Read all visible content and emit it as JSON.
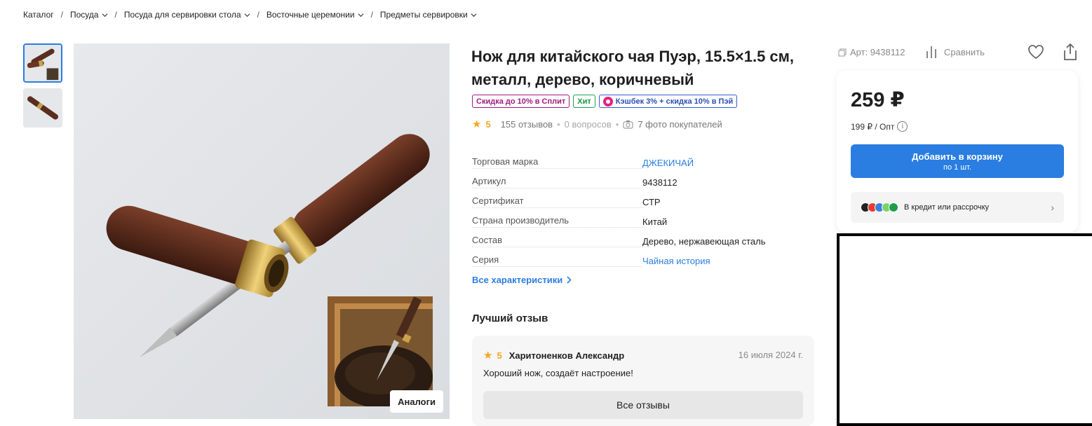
{
  "breadcrumbs": [
    {
      "label": "Каталог",
      "has_dropdown": false
    },
    {
      "label": "Посуда",
      "has_dropdown": true
    },
    {
      "label": "Посуда для сервировки стола",
      "has_dropdown": true
    },
    {
      "label": "Восточные церемонии",
      "has_dropdown": true
    },
    {
      "label": "Предметы сервировки",
      "has_dropdown": true
    }
  ],
  "gallery": {
    "thumb_count": 2,
    "active_thumb": 1,
    "analogs_label": "Аналоги"
  },
  "product": {
    "title": "Нож для китайского чая Пуэр, 15.5×1.5 см, металл, дерево, коричневый",
    "badges": {
      "split": "Скидка до 10% в Сплит",
      "hit": "Хит",
      "cashback": "Кэшбек 3% + скидка 10% в Пэй"
    },
    "rating": {
      "value": "5",
      "reviews": "155 отзывов",
      "questions": "0 вопросов",
      "photos": "7 фото покупателей"
    },
    "specs": [
      {
        "key": "Торговая марка",
        "value": "ДЖЕКИЧАЙ",
        "link": true
      },
      {
        "key": "Артикул",
        "value": "9438112",
        "link": false
      },
      {
        "key": "Сертификат",
        "value": "СТР",
        "link": false
      },
      {
        "key": "Страна производитель",
        "value": "Китай",
        "link": false
      },
      {
        "key": "Состав",
        "value": "Дерево, нержавеющая сталь",
        "link": false
      },
      {
        "key": "Серия",
        "value": "Чайная история",
        "link": true
      }
    ],
    "all_specs_label": "Все характеристики"
  },
  "best_review": {
    "section_title": "Лучший отзыв",
    "rating": "5",
    "author": "Харитоненков Александр",
    "date": "16 июля 2024 г.",
    "text": "Хороший нож, создаёт настроение!",
    "all_reviews_label": "Все отзывы"
  },
  "actions": {
    "article": "Арт: 9438112",
    "compare": "Сравнить"
  },
  "purchase": {
    "price": "259 ₽",
    "wholesale": "199 ₽ / Опт",
    "add_to_cart": "Добавить в корзину",
    "add_to_cart_sub": "по 1 шт.",
    "credit": "В кредит или рассрочку"
  },
  "colors": {
    "accent": "#2a7de1",
    "star": "#f5a623",
    "split": "#a11a7e",
    "hit": "#1aa350",
    "cashback": "#3a5bd0"
  }
}
